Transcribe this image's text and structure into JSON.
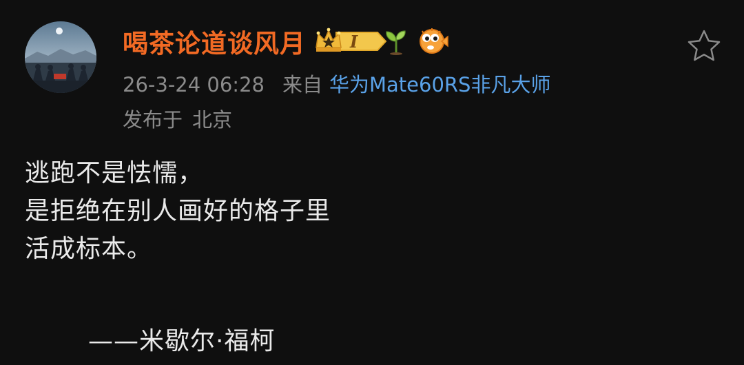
{
  "post": {
    "author": {
      "name": "喝茶论道谈风月",
      "level_badge_text": "I",
      "avatar_icon": "avatar-image"
    },
    "meta": {
      "time": "26-3-24 06:28",
      "source_prefix": "来自",
      "device": "华为Mate60RS非凡大师",
      "location_prefix": "发布于",
      "location": "北京"
    },
    "content_lines": [
      "逃跑不是怯懦，",
      "是拒绝在别人画好的格子里",
      "活成标本。"
    ],
    "attribution": "——米歇尔·福柯",
    "icons": {
      "crown": "crown-icon",
      "sprout": "sprout-icon",
      "fish": "pufferfish-icon",
      "favorite": "star-outline-icon"
    },
    "colors": {
      "username": "#f26a24",
      "device_link": "#5aa2e8",
      "meta_text": "#8b8b8b",
      "background": "#0f0f0f"
    }
  }
}
